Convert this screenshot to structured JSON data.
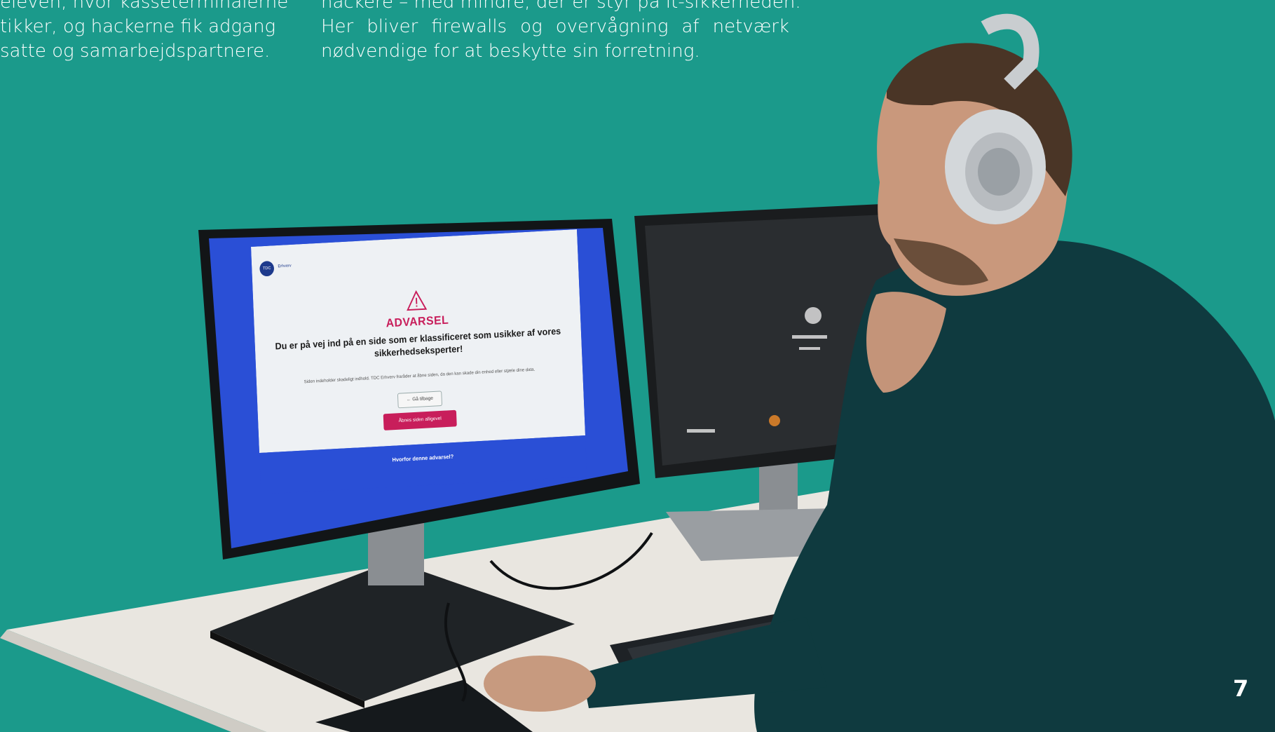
{
  "column_left": {
    "lines": [
      "eleven, hvor kasseterminalerne",
      "tikker, og hackerne fik adgang",
      "satte og samarbejdspartnere."
    ]
  },
  "column_right": {
    "lines": [
      "hackere – med mindre, der er styr på it-sikkerheden.",
      "Her bliver firewalls og overvågning af netværk",
      "nødvendige for at beskytte sin forretning."
    ]
  },
  "left_screen": {
    "brand": "Erhverv",
    "logo_text": "TDC",
    "warning_title": "ADVARSEL",
    "warning_heading": "Du er på vej ind på en side som er klassificeret som usikker af vores sikkerhedseksperter!",
    "warning_body": "Siden indeholder skadeligt indhold. TDC Erhverv fraråder at åbne siden, da den kan skade din enhed eller stjæle dine data.",
    "back_button": "← Gå tilbage",
    "open_button": "Åbnes siden alligevel",
    "why_link": "Hvorfor denne advarsel?"
  },
  "page_number": "7",
  "colors": {
    "background": "#1b9a8b",
    "warning_accent": "#c81e5b",
    "screen_blue": "#2a4fd6",
    "sweater": "#0f3a3f"
  }
}
